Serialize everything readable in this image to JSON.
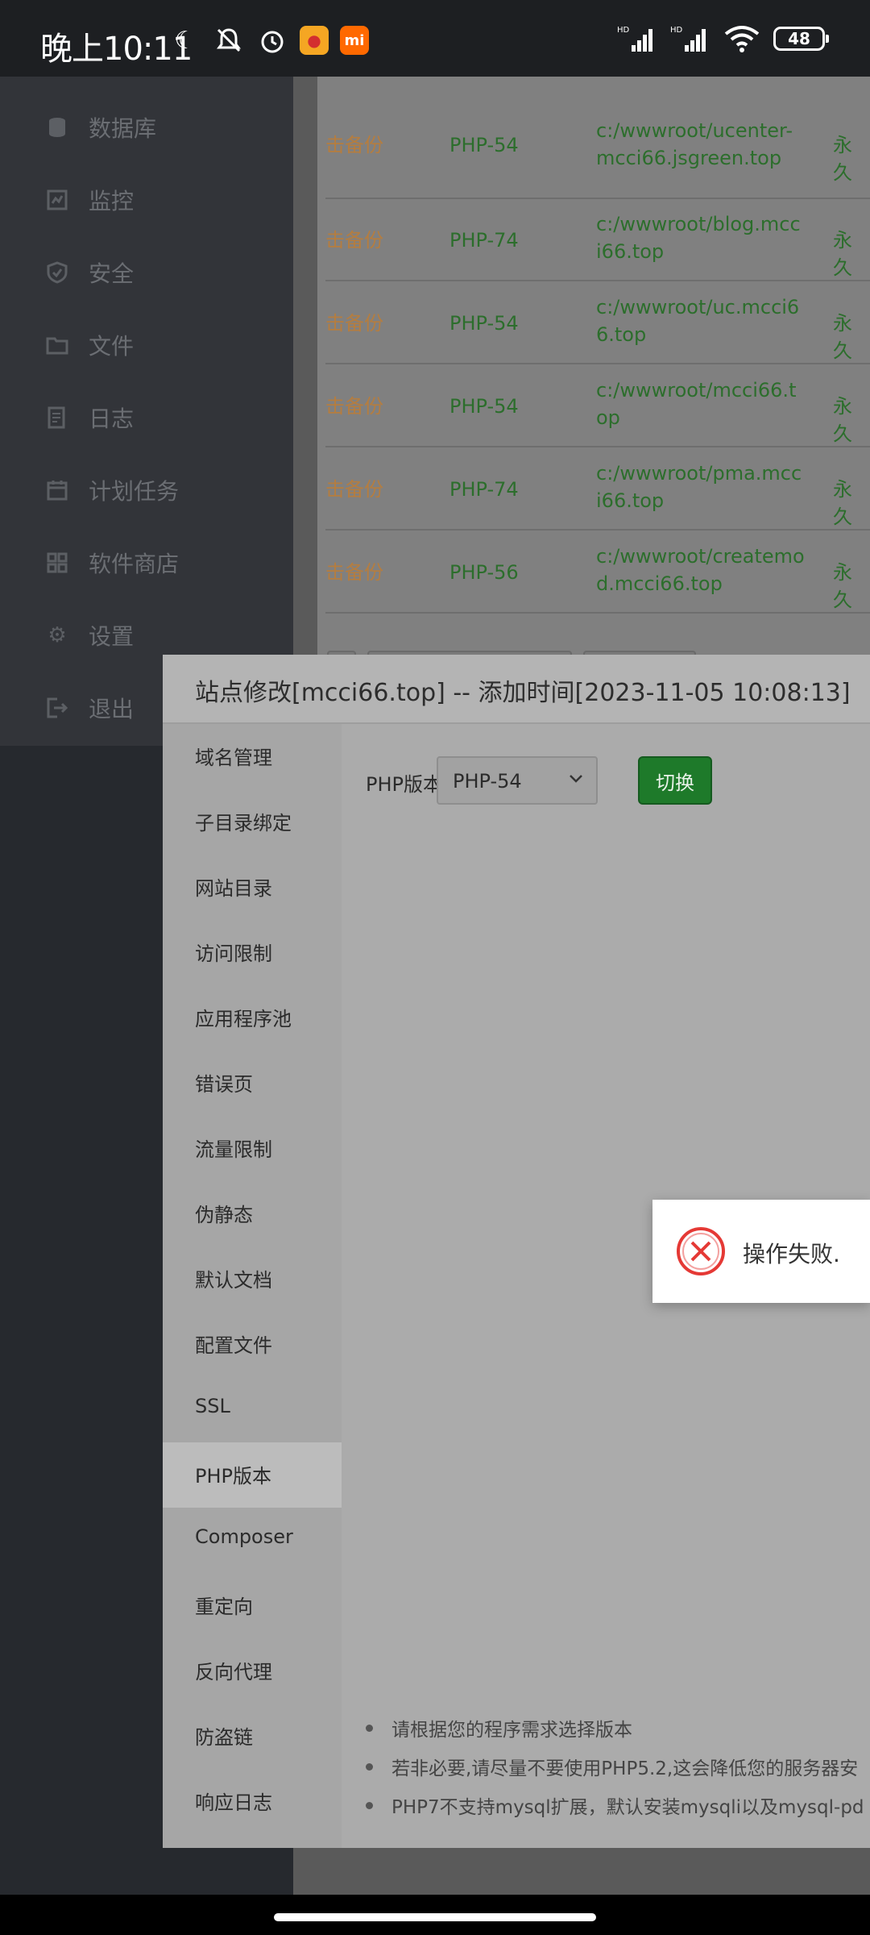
{
  "status_bar": {
    "time": "晚上10:11",
    "battery": "48",
    "signal_label_1": "HD",
    "signal_label_2": "HD"
  },
  "sidebar": {
    "items": [
      {
        "label": "数据库",
        "icon": "database-icon"
      },
      {
        "label": "监控",
        "icon": "monitor-icon"
      },
      {
        "label": "安全",
        "icon": "shield-icon"
      },
      {
        "label": "文件",
        "icon": "folder-icon"
      },
      {
        "label": "日志",
        "icon": "log-icon"
      },
      {
        "label": "计划任务",
        "icon": "calendar-icon"
      },
      {
        "label": "软件商店",
        "icon": "grid-icon"
      },
      {
        "label": "设置",
        "icon": "gear-icon"
      },
      {
        "label": "退出",
        "icon": "logout-icon"
      }
    ]
  },
  "site_table": {
    "rows": [
      {
        "backup": "击备份",
        "php": "PHP-54",
        "path": "c:/wwwroot/ucenter-mcci66.jsgreen.top",
        "expiry": "永久"
      },
      {
        "backup": "击备份",
        "php": "PHP-74",
        "path": "c:/wwwroot/blog.mcci66.top",
        "expiry": "永久"
      },
      {
        "backup": "击备份",
        "php": "PHP-54",
        "path": "c:/wwwroot/uc.mcci66.top",
        "expiry": "永久"
      },
      {
        "backup": "击备份",
        "php": "PHP-54",
        "path": "c:/wwwroot/mcci66.top",
        "expiry": "永久"
      },
      {
        "backup": "击备份",
        "php": "PHP-74",
        "path": "c:/wwwroot/pma.mcci66.top",
        "expiry": "永久"
      },
      {
        "backup": "击备份",
        "php": "PHP-56",
        "path": "c:/wwwroot/createmod.mcci66.top",
        "expiry": "永久"
      }
    ]
  },
  "dialog": {
    "title": "站点修改[mcci66.top] -- 添加时间[2023-11-05 10:08:13]",
    "nav": [
      "域名管理",
      "子目录绑定",
      "网站目录",
      "访问限制",
      "应用程序池",
      "错误页",
      "流量限制",
      "伪静态",
      "默认文档",
      "配置文件",
      "SSL",
      "PHP版本",
      "Composer",
      "重定向",
      "反向代理",
      "防盗链",
      "响应日志"
    ],
    "active_nav": "PHP版本",
    "php_label": "PHP版本",
    "php_selected": "PHP-54",
    "switch_label": "切换",
    "tips": [
      "请根据您的程序需求选择版本",
      "若非必要,请尽量不要使用PHP5.2,这会降低您的服务器安",
      "PHP7不支持mysql扩展，默认安装mysqli以及mysql-pd"
    ]
  },
  "toast": {
    "message": "操作失败."
  },
  "colors": {
    "success_green": "#1e7a2a",
    "error_red": "#e53935",
    "backup_orange": "#b57d3f"
  }
}
